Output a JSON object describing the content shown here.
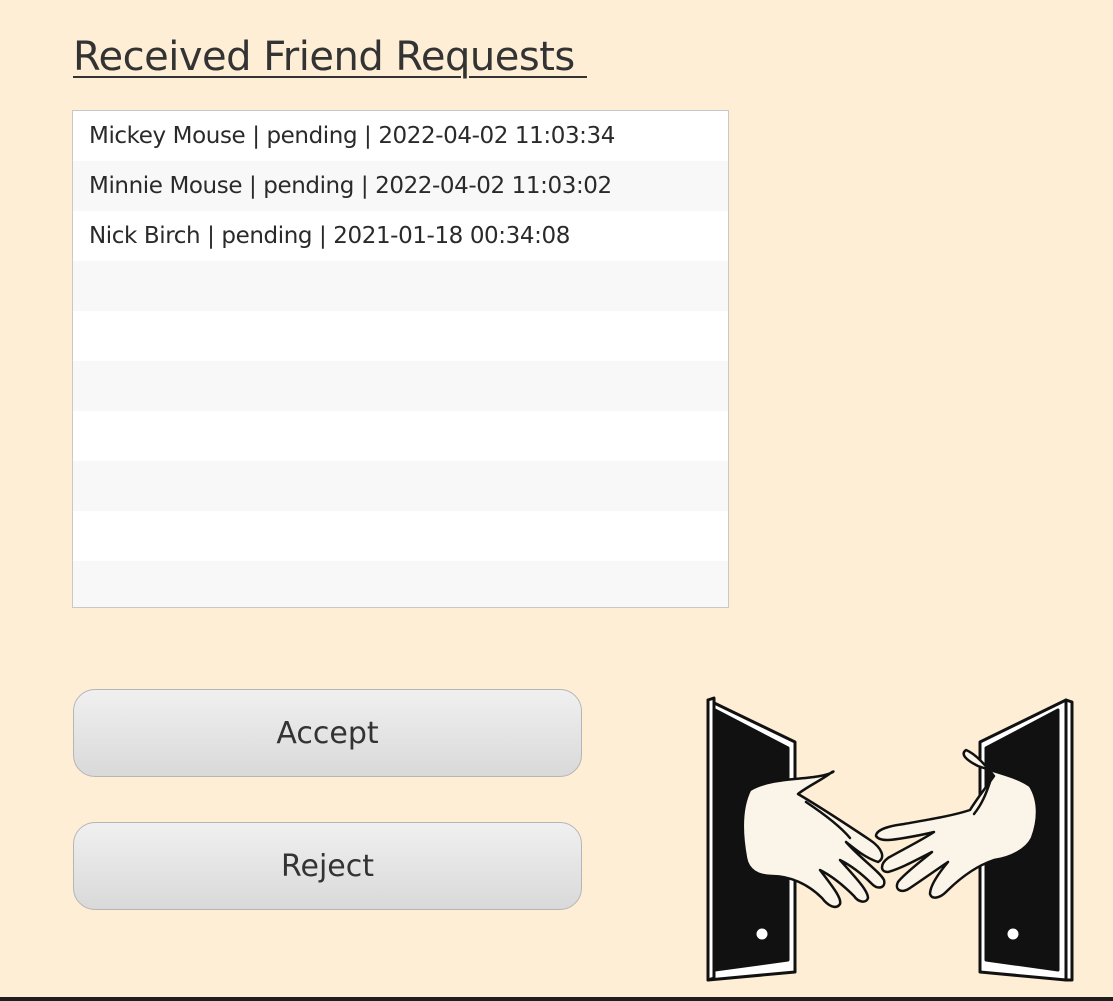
{
  "header": {
    "title": "Received Friend Requests "
  },
  "requests": {
    "items": [
      "Mickey Mouse | pending | 2022-04-02 11:03:34",
      "Minnie Mouse | pending | 2022-04-02 11:03:02",
      "Nick Birch | pending | 2021-01-18 00:34:08",
      "",
      "",
      "",
      "",
      "",
      "",
      ""
    ]
  },
  "actions": {
    "accept_label": "Accept",
    "reject_label": "Reject"
  },
  "illustration": {
    "icon": "handshake-phones-icon"
  },
  "colors": {
    "background": "#feeed5",
    "text": "#333333"
  }
}
